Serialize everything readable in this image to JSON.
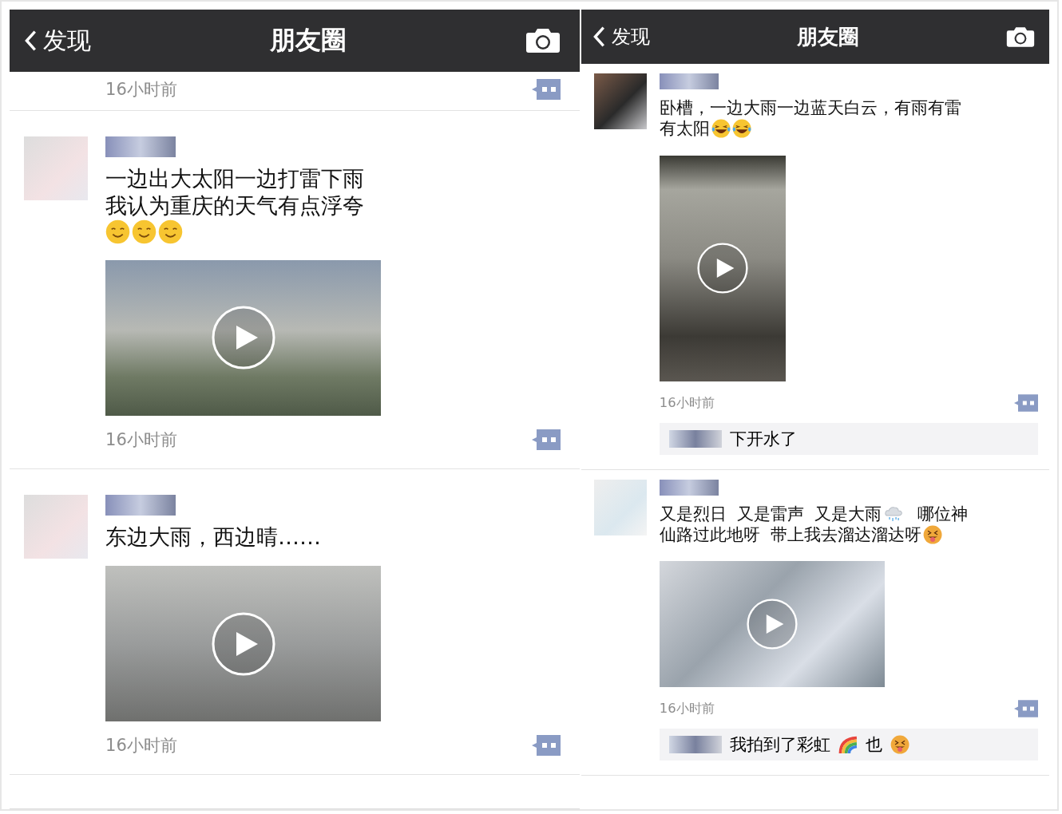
{
  "panels": [
    {
      "header": {
        "back": "发现",
        "title": "朋友圈"
      },
      "top_stub": {
        "time": "16小时前"
      },
      "posts": [
        {
          "lines": [
            [
              {
                "kind": "text",
                "text": "一边出大太阳一边打雷下雨"
              }
            ],
            [
              {
                "kind": "text",
                "text": "我认为重庆的天气有点浮夸"
              }
            ],
            [
              {
                "kind": "smile"
              },
              {
                "kind": "smile"
              },
              {
                "kind": "smile"
              }
            ]
          ],
          "time": "16小时前"
        },
        {
          "lines": [
            [
              {
                "kind": "text",
                "text": "东边大雨，西边晴……"
              }
            ]
          ],
          "time": "16小时前"
        }
      ]
    },
    {
      "header": {
        "back": "发现",
        "title": "朋友圈"
      },
      "posts": [
        {
          "lines": [
            [
              {
                "kind": "text",
                "text": "卧槽，一边大雨一边蓝天白云，有雨有雷"
              }
            ],
            [
              {
                "kind": "text",
                "text": "有太阳"
              },
              {
                "kind": "laugh"
              },
              {
                "kind": "laugh"
              }
            ]
          ],
          "time": "16小时前",
          "comments": [
            {
              "segments": [
                {
                  "kind": "text",
                  "text": "下开水了"
                }
              ]
            }
          ]
        },
        {
          "lines": [
            [
              {
                "kind": "text",
                "text": "又是烈日  又是雷声  又是大雨"
              },
              {
                "kind": "rain"
              },
              {
                "kind": "text",
                "text": "哪位神"
              }
            ],
            [
              {
                "kind": "text",
                "text": "仙路过此地呀  带上我去溜达溜达呀"
              },
              {
                "kind": "tongue"
              }
            ]
          ],
          "time": "16小时前",
          "comments": [
            {
              "segments": [
                {
                  "kind": "text",
                  "text": "我拍到了彩虹"
                },
                {
                  "kind": "rainbow"
                },
                {
                  "kind": "text",
                  "text": "也"
                },
                {
                  "kind": "tongue"
                }
              ]
            }
          ]
        }
      ]
    }
  ]
}
